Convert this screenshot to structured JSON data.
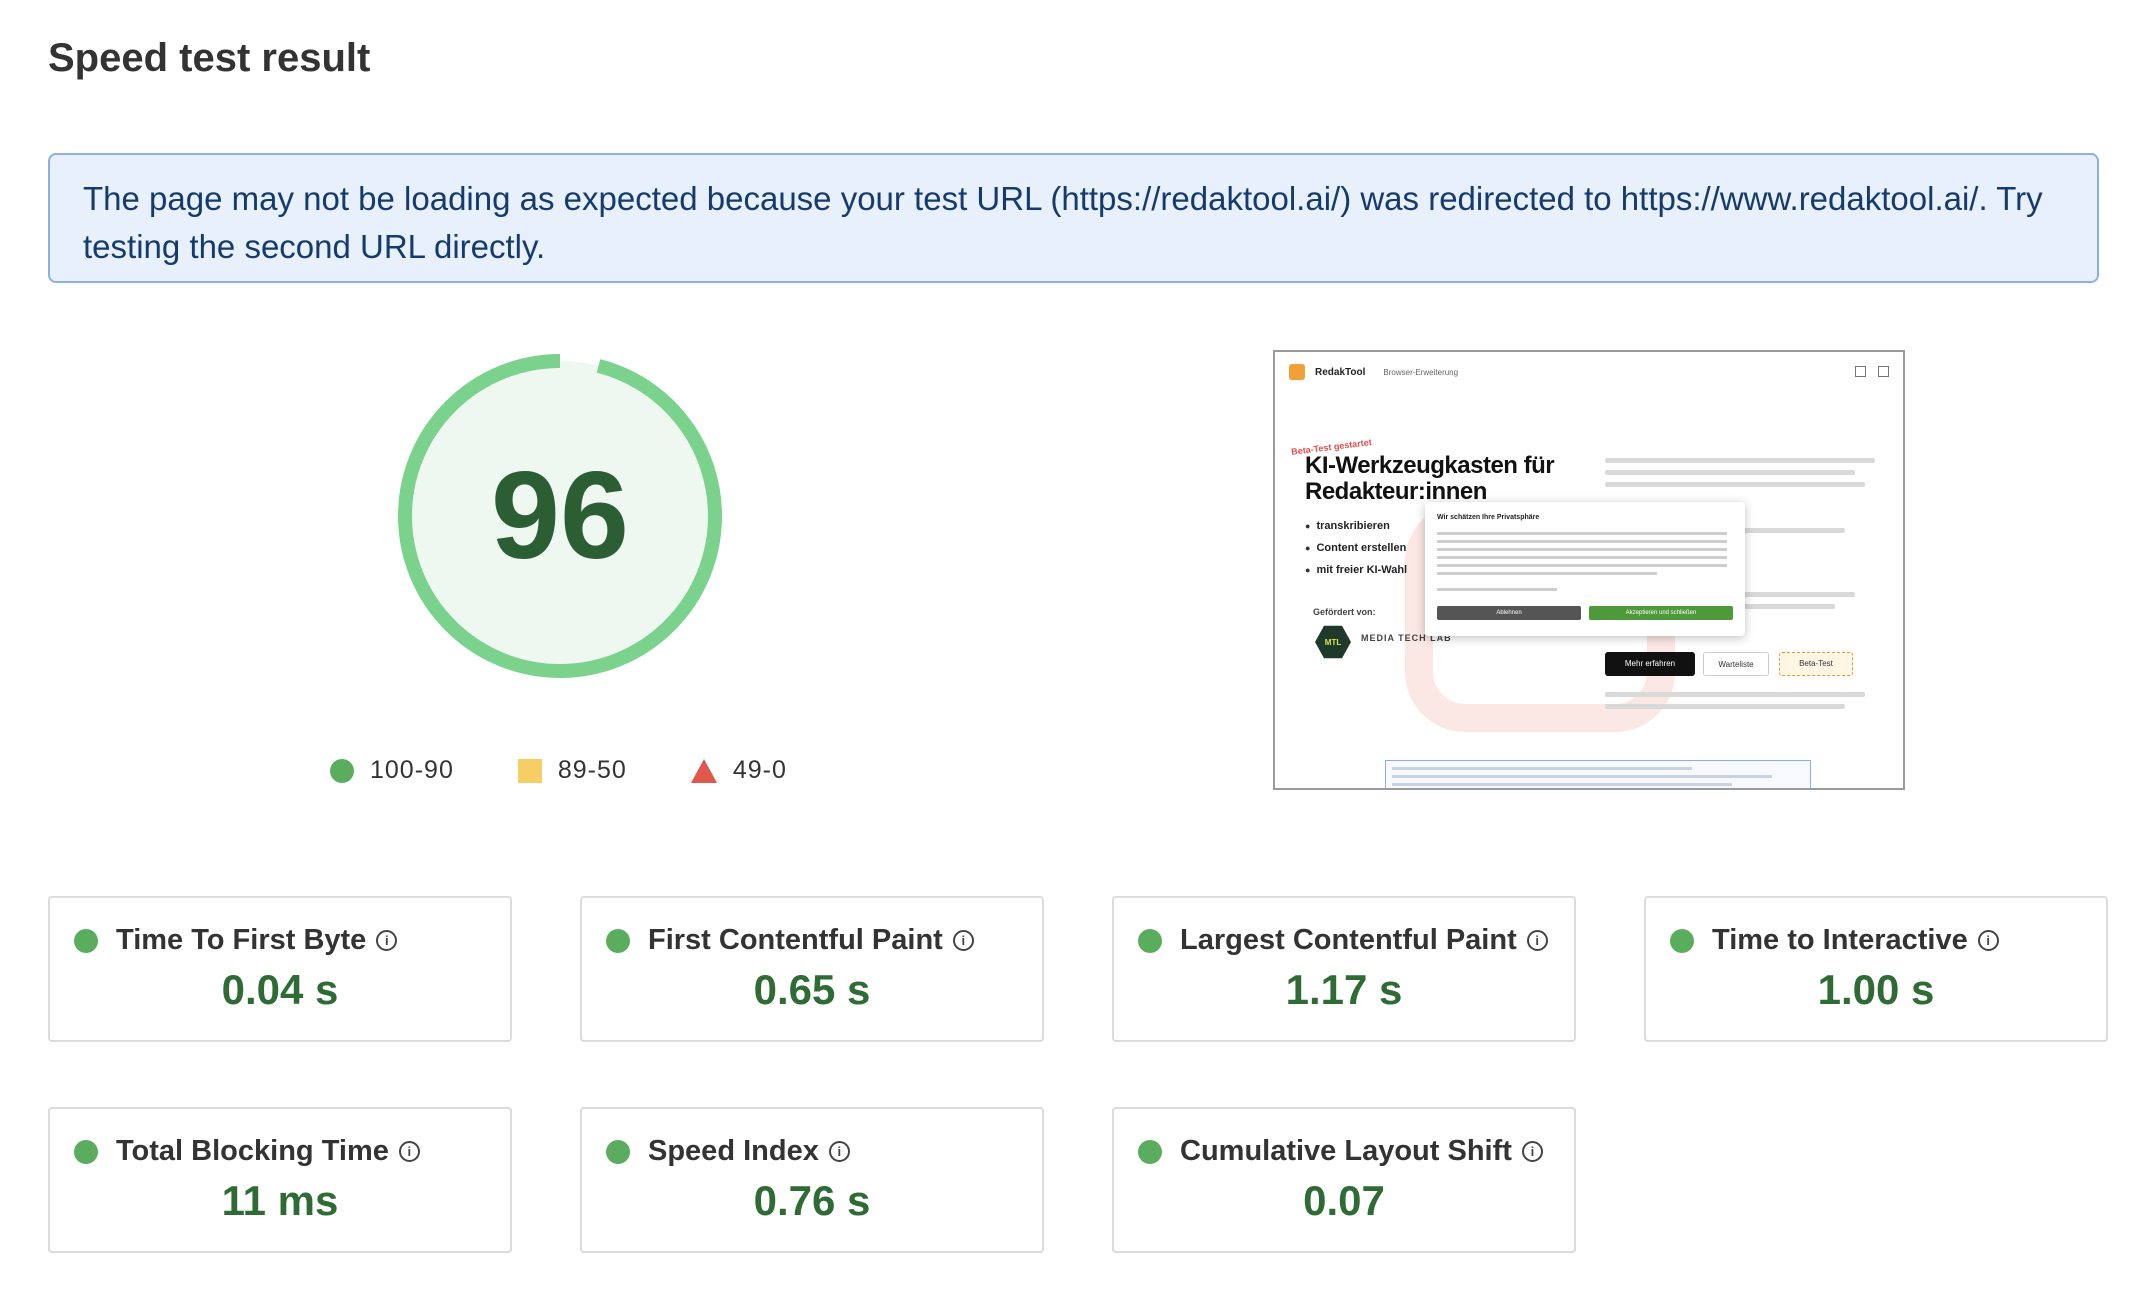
{
  "page_title": "Speed test result",
  "alert_text": "The page may not be loading as expected because your test URL (https://redaktool.ai/) was redirected to https://www.redaktool.ai/. Try testing the second URL directly.",
  "score": {
    "value": "96",
    "fraction": 0.96,
    "color": "#7ad28c"
  },
  "legend": [
    {
      "label": "100-90",
      "shape": "circle",
      "color": "#5aad5d"
    },
    {
      "label": "89-50",
      "shape": "square",
      "color": "#f5cf66"
    },
    {
      "label": "49-0",
      "shape": "triangle",
      "color": "#e0574c"
    }
  ],
  "screenshot": {
    "brand": "RedakTool",
    "nav": "Browser-Erweiterung",
    "beta_tag": "Beta-Test gestartet",
    "hero_line1": "KI-Werkzeugkasten für",
    "hero_line2": "Redakteur:innen",
    "features": [
      "transkribieren",
      "Content erstellen",
      "mit freier KI-Wahl"
    ],
    "gefoerdert": "Gefördert von:",
    "mtl": "MTL",
    "mtl_name": "MEDIA TECH LAB",
    "cookie_title": "Wir schätzen Ihre Privatsphäre",
    "cookie_reject": "Ablehnen",
    "cookie_accept": "Akzeptieren und schließen",
    "btn_more": "Mehr erfahren",
    "btn_wait": "Warteliste",
    "btn_beta": "Beta-Test"
  },
  "metrics": [
    {
      "label": "Time To First Byte",
      "value": "0.04 s"
    },
    {
      "label": "First Contentful Paint",
      "value": "0.65 s"
    },
    {
      "label": "Largest Contentful Paint",
      "value": "1.17 s"
    },
    {
      "label": "Time to Interactive",
      "value": "1.00 s"
    },
    {
      "label": "Total Blocking Time",
      "value": "11 ms"
    },
    {
      "label": "Speed Index",
      "value": "0.76 s"
    },
    {
      "label": "Cumulative Layout Shift",
      "value": "0.07"
    }
  ],
  "info_icon": "i"
}
